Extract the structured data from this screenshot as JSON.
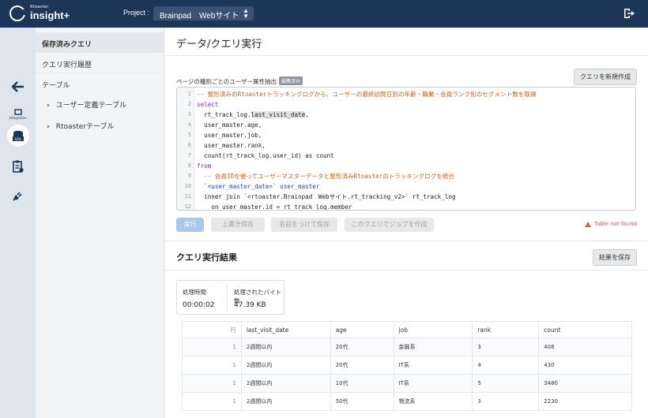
{
  "header": {
    "logo_small": "Rtoaster",
    "logo_big": "insight+",
    "project_label": "Project :",
    "project_value": "Brainpad　Webサイト"
  },
  "rail": {
    "items": [
      {
        "icon": "arrow-left-icon"
      },
      {
        "icon": "integration-icon",
        "label": "Integration"
      },
      {
        "icon": "sql-icon",
        "label": "SQL"
      },
      {
        "icon": "report-icon"
      },
      {
        "icon": "plug-icon"
      }
    ]
  },
  "sidebar": {
    "saved_queries": "保存済みクエリ",
    "history": "クエリ実行履歴",
    "tables": "テーブル",
    "user_tables": "ユーザー定義テーブル",
    "rtoaster_tables": "Rtoasterテーブル"
  },
  "main": {
    "title": "データ/クエリ実行",
    "query_name": "ページの種別ごとのユーザー属性抽出",
    "badge": "編集済み",
    "new_query_button": "クエリを新規作成",
    "code_lines": [
      {
        "n": "1",
        "text": "-- 整形済みのRtoasterトラッキングログから、ユーザーの最終訪問日別の年齢・職業・会員ランク別のセグメント数を取得"
      },
      {
        "n": "2",
        "text": "select"
      },
      {
        "n": "3",
        "text": "  rt_track_log.last_visit_date,"
      },
      {
        "n": "4",
        "text": "  user_master.age,"
      },
      {
        "n": "5",
        "text": "  user_master.job,"
      },
      {
        "n": "6",
        "text": "  user_master.rank,"
      },
      {
        "n": "7",
        "text": "  count(rt_track_log.user_id) as count"
      },
      {
        "n": "8",
        "text": "from"
      },
      {
        "n": "9",
        "text": "  -- 会員IDを使ってユーザーマスターデータと整形済みRtoasterのトラッキングログを統合"
      },
      {
        "n": "10",
        "text": "  `<user_master_date>` user_master"
      },
      {
        "n": "11",
        "text": "  inner join `<rtoaster.Brainpad　Webサイト.rt_tracking_v2>` rt_track_log"
      },
      {
        "n": "12",
        "text": "    on user_master.id = rt_track_log.member"
      }
    ],
    "buttons": {
      "run": "実行",
      "overwrite": "上書き保存",
      "save_as": "名前をつけて保存",
      "create_job": "このクエリでジョブを作成"
    },
    "warning": "Table not found",
    "results_title": "クエリ実行結果",
    "save_results": "結果を保存",
    "stats": {
      "time_label": "処理時間",
      "time_value": "00:00:02",
      "bytes_label": "処理されたバイト数",
      "bytes_value": "47.39 KB"
    },
    "table": {
      "headers": [
        "行",
        "last_visit_date",
        "age",
        "job",
        "rank",
        "count"
      ],
      "rows": [
        [
          "1",
          "2週間以内",
          "20代",
          "金融系",
          "3",
          "408"
        ],
        [
          "1",
          "2週間以内",
          "20代",
          "IT系",
          "4",
          "430"
        ],
        [
          "1",
          "2週間以内",
          "10代",
          "IT系",
          "5",
          "3480"
        ],
        [
          "1",
          "2週間以内",
          "50代",
          "物流系",
          "3",
          "2230"
        ]
      ]
    }
  }
}
